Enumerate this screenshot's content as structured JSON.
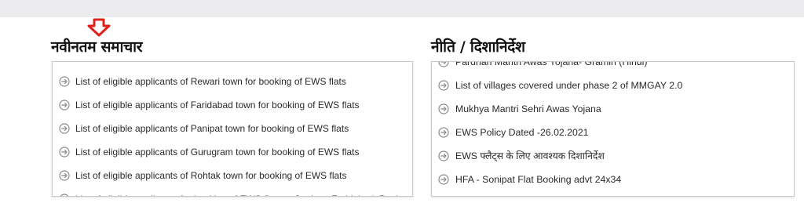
{
  "sections": {
    "latest_news": {
      "title": "नवीनतम समाचार",
      "items": [
        "List of eligible applicants of Rewari town for booking of EWS flats",
        "List of eligible applicants of Faridabad town for booking of EWS flats",
        "List of eligible applicants of Panipat town for booking of EWS flats",
        "List of eligible applicants of Gurugram town for booking of EWS flats",
        "List of eligible applicants of Rohtak town for booking of EWS flats",
        "List of eligible applicants for booking of EWS flats at Sonipat, Faridabad, Panipat, Rohtak"
      ]
    },
    "policy_guidelines": {
      "title": "नीति / दिशानिर्देश",
      "items": [
        "Pardhan Mantri Awas Yojana- Gramin (Hindi)",
        "List of villages covered under phase 2 of MMGAY 2.0",
        "Mukhya Mantri Sehri Awas Yojana",
        "EWS Policy Dated -26.02.2021",
        "EWS फ्लैट्स के लिए आवश्यक दिशानिर्देश",
        "HFA - Sonipat Flat Booking advt 24x34"
      ]
    }
  },
  "icons": {
    "pointer": "down-arrow-icon",
    "bullet": "circle-arrow-right-icon"
  },
  "colors": {
    "pointer_red": "#e0201a",
    "bullet_grey": "#8a8a8a",
    "topbar": "#ececee"
  }
}
